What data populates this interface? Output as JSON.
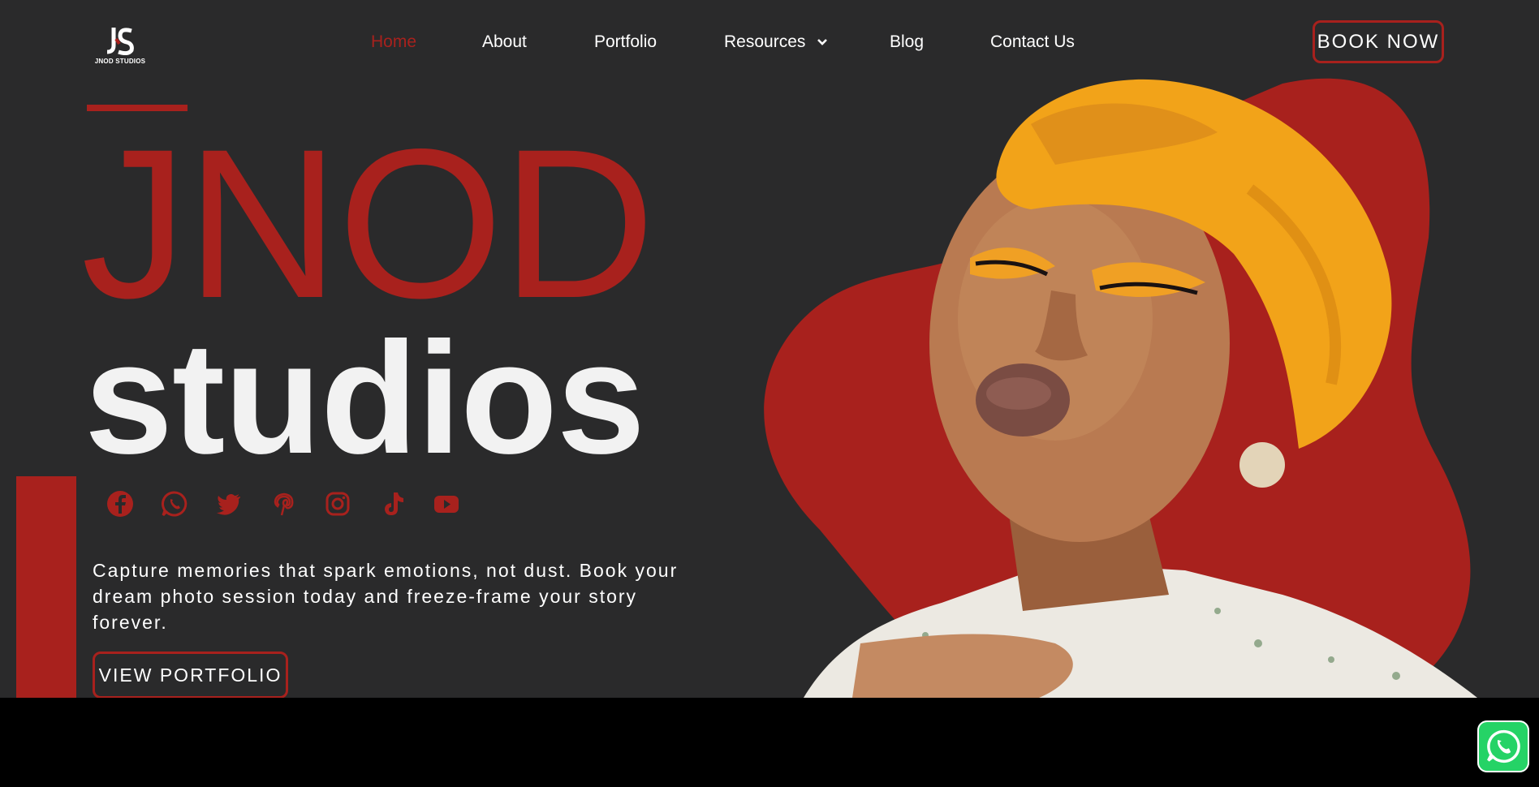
{
  "brand": {
    "logo_mark": "JS",
    "logo_text": "JNOD STUDIOS",
    "accent": "#a8211d",
    "background": "#2a2a2b"
  },
  "nav": {
    "items": [
      {
        "label": "Home",
        "active": true
      },
      {
        "label": "About",
        "active": false
      },
      {
        "label": "Portfolio",
        "active": false
      },
      {
        "label": "Resources",
        "active": false,
        "icon": "chevron-down-icon"
      },
      {
        "label": "Blog",
        "active": false
      },
      {
        "label": "Contact Us",
        "active": false
      }
    ],
    "cta_label": "BOOK NOW"
  },
  "hero": {
    "title_line1": "JNOD",
    "title_line2": "studios",
    "tagline": "Capture memories that spark emotions, not dust. Book your dream photo session today and freeze-frame your story forever.",
    "cta_label": "VIEW PORTFOLIO",
    "image_description": "portrait-of-woman-in-orange-headwrap"
  },
  "socials": [
    {
      "name": "facebook-icon"
    },
    {
      "name": "whatsapp-icon"
    },
    {
      "name": "twitter-icon"
    },
    {
      "name": "pinterest-icon"
    },
    {
      "name": "instagram-icon"
    },
    {
      "name": "tiktok-icon"
    },
    {
      "name": "youtube-icon"
    }
  ],
  "floating": {
    "whatsapp": "whatsapp-chat-icon",
    "whatsapp_color": "#25d366"
  }
}
